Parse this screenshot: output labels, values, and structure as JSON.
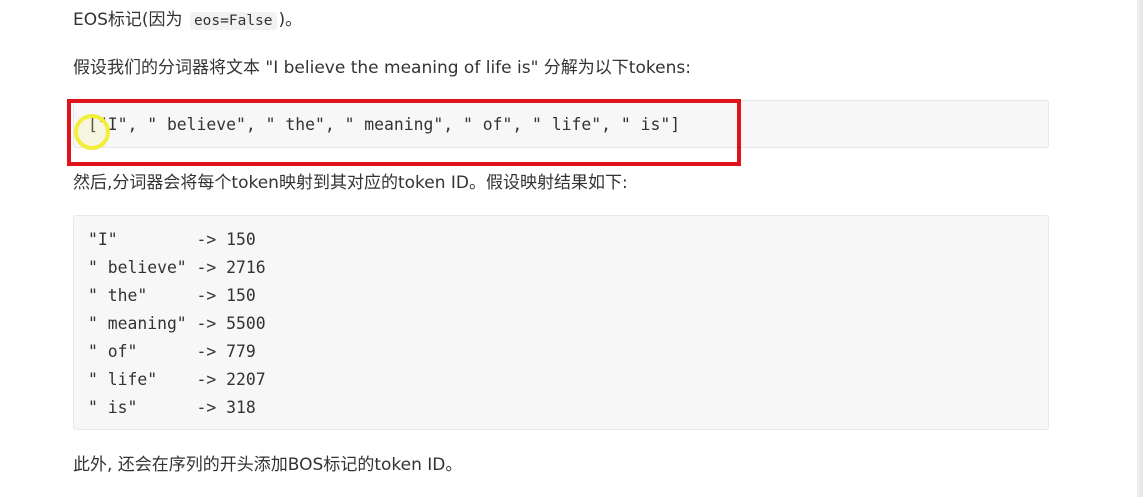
{
  "paragraphs": {
    "p1_prefix": "EOS标记(因为 ",
    "p1_code": "eos=False",
    "p1_suffix": ")。",
    "p2": "假设我们的分词器将文本 \"I believe the meaning of life is\" 分解为以下tokens:",
    "p3": "然后,分词器会将每个token映射到其对应的token ID。假设映射结果如下:",
    "p4": "此外, 还会在序列的开头添加BOS标记的token ID。"
  },
  "token_list_code": "[\"I\", \" believe\", \" the\", \" meaning\", \" of\", \" life\", \" is\"]",
  "mapping_code": [
    "\"I\"        -> 150",
    "\" believe\" -> 2716",
    "\" the\"     -> 150",
    "\" meaning\" -> 5500",
    "\" of\"      -> 779",
    "\" life\"    -> 2207",
    "\" is\"      -> 318"
  ],
  "colors": {
    "highlight_border": "#e0121c",
    "cursor_ring": "#f3ee3a",
    "code_background": "#f7f7f7",
    "text": "#333333"
  }
}
